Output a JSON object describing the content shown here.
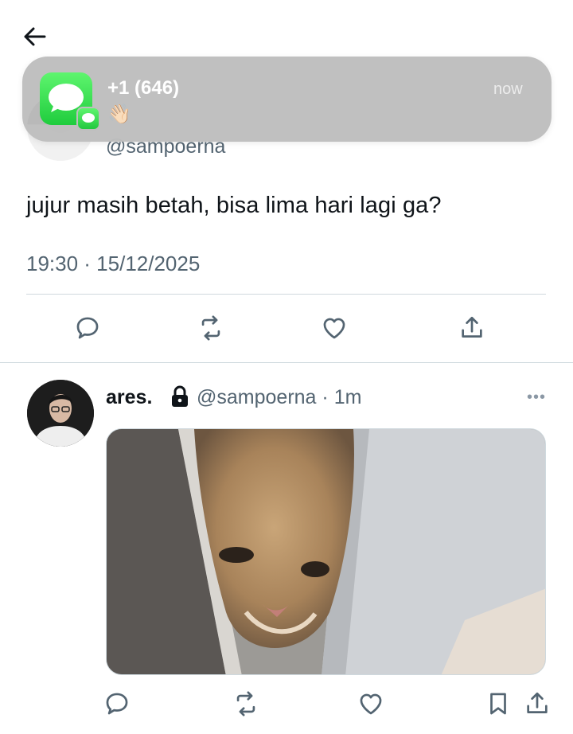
{
  "top_tweet": {
    "handle": "@sampoerna",
    "text": "jujur masih betah, bisa lima hari lagi ga?",
    "timestamp": "19:30 · 15/12/2025"
  },
  "notification": {
    "app_icon": "messages-icon",
    "sender": "+1 (646)",
    "emoji": "👋🏻",
    "time": "now"
  },
  "second_tweet": {
    "name": "ares.",
    "handle": "@sampoerna",
    "time_sep": "·",
    "time": "1m",
    "more": "•••",
    "media": "cat-photo"
  },
  "actions": [
    "reply-icon",
    "retweet-icon",
    "like-icon",
    "share-icon",
    "bookmark-icon"
  ],
  "colors": {
    "text": "#0f1419",
    "muted": "#536471",
    "divider": "#cfd9de",
    "messages_green": "#34c759"
  }
}
